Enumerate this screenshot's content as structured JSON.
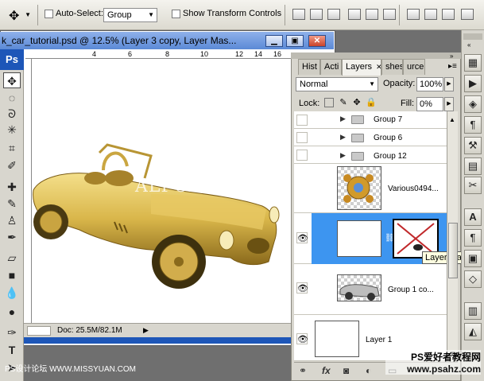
{
  "options_bar": {
    "auto_select_label": "Auto-Select:",
    "auto_select_value": "Group",
    "show_transform_label": "Show Transform Controls"
  },
  "document": {
    "title": "k_car_tutorial.psd @ 12.5% (Layer 3 copy, Layer Mas...",
    "ruler_ticks": [
      "4",
      "6",
      "8",
      "10",
      "12",
      "14",
      "16"
    ],
    "doc_status": "Doc: 25.5M/82.1M",
    "canvas_watermark": "ALFOART.COM"
  },
  "toolbox": {
    "app_label": "Ps"
  },
  "panel": {
    "tabs": [
      "Hist",
      "Acti",
      "Layers",
      "shes",
      "urce"
    ],
    "blend_mode": "Normal",
    "opacity_label": "Opacity:",
    "opacity_value": "100%",
    "lock_label": "Lock:",
    "fill_label": "Fill:",
    "fill_value": "0%",
    "layers": [
      {
        "name": "Group 7",
        "type": "group",
        "visible": false
      },
      {
        "name": "Group 6",
        "type": "group",
        "visible": false
      },
      {
        "name": "Group 12",
        "type": "group",
        "visible": false
      },
      {
        "name": "Various0494...",
        "type": "image",
        "visible": false
      },
      {
        "name": "",
        "type": "masked",
        "visible": true,
        "selected": true
      },
      {
        "name": "Group 1 co...",
        "type": "image",
        "visible": true
      },
      {
        "name": "Layer 1",
        "type": "plain",
        "visible": true
      }
    ],
    "tooltip": "Layer mask thu",
    "bottom_icons": [
      "link-icon",
      "fx-icon",
      "mask-icon",
      "adjustment-icon",
      "folder-icon",
      "new-layer-icon",
      "trash-icon"
    ]
  },
  "watermarks": {
    "bottom_left": "PS设计论坛 WWW.MISSYUAN.COM",
    "bottom_right_line1": "PS爱好者教程网",
    "bottom_right_line2": "www.psahz.com"
  },
  "colors": {
    "selection_blue": "#3d95f0",
    "title_blue": "#5b89d6",
    "car_gold": "#d9b64a"
  }
}
